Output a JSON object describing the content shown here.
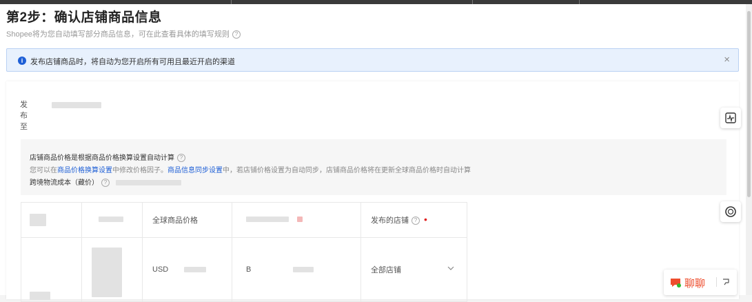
{
  "header": {
    "title": "第2步：确认店铺商品信息",
    "subtitle": "Shopee将为您自动填写部分商品信息，可在此查看具体的填写规则"
  },
  "notice": {
    "message": "发布店铺商品时，将自动为您开启所有可用且最近开启的渠道",
    "close": "×"
  },
  "publish": {
    "label": "发布至"
  },
  "info": {
    "line1": "店铺商品价格是根据商品价格换算设置自动计算",
    "line2_pre": "您可以在",
    "line2_link1": "商品价格换算设置",
    "line2_mid": "中修改价格因子。",
    "line2_link2": "商品信息同步设置",
    "line2_post": "中，若店铺价格设置为自动同步，店铺商品价格将在更新全球商品价格时自动计算",
    "line3": "跨境物流成本（藏价）"
  },
  "table": {
    "headers": {
      "global_price": "全球商品价格",
      "shops": "发布的店铺"
    },
    "row": {
      "currency": "USD",
      "col4_prefix": "B",
      "shop_value": "全部店铺"
    }
  },
  "chat": {
    "label": "聊聊"
  },
  "colors": {
    "accent": "#1e5fd6",
    "brand": "#ee4d2d",
    "required": "#e02020"
  }
}
